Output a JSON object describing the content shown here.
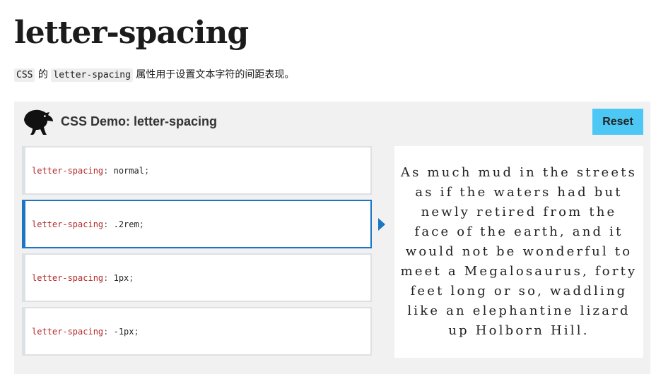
{
  "page": {
    "title": "letter-spacing",
    "intro": {
      "code1": "CSS",
      "text1": " 的 ",
      "code2": "letter-spacing",
      "text2": " 属性用于设置文本字符的间距表现。"
    }
  },
  "demo": {
    "title": "CSS Demo: letter-spacing",
    "logo_icon": "dino-icon",
    "reset_label": "Reset",
    "choices": [
      {
        "property": "letter-spacing",
        "colon": ": ",
        "value": "normal",
        "semicolon": ";"
      },
      {
        "property": "letter-spacing",
        "colon": ": ",
        "value": ".2rem",
        "semicolon": ";"
      },
      {
        "property": "letter-spacing",
        "colon": ": ",
        "value": "1px",
        "semicolon": ";"
      },
      {
        "property": "letter-spacing",
        "colon": ": ",
        "value": "-1px",
        "semicolon": ";"
      }
    ],
    "selected_index": 1,
    "output_text": "As much mud in the streets as if the waters had but newly retired from the face of the earth, and it would not be wonderful to meet a Megalosaurus, forty feet long or so, waddling like an elephantine lizard up Holborn Hill."
  },
  "colors": {
    "accent": "#1b76c4",
    "reset_button": "#4dc7f4",
    "demo_background": "#f1f1f1",
    "property_text": "#b22a2a"
  }
}
